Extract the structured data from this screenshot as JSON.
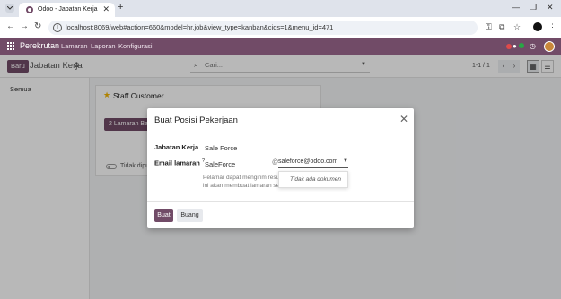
{
  "browser": {
    "tab_title": "Odoo - Jabatan Kerja",
    "new_tab": "+",
    "url": "localhost:8069/web#action=660&model=hr.job&view_type=kanban&cids=1&menu_id=471"
  },
  "navbar": {
    "brand": "Perekrutan",
    "menu": [
      "Lamaran",
      "Laporan",
      "Konfigurasi"
    ],
    "colors": {
      "primary": "#714b67"
    }
  },
  "controlpanel": {
    "new_button": "Baru",
    "title": "Jabatan Kerja",
    "search_placeholder": "Cari...",
    "pager": "1-1 / 1"
  },
  "sidebar": {
    "items": [
      {
        "label": "Semua"
      }
    ]
  },
  "card": {
    "title": "Staff Customer",
    "button": "2 Lamaran Baru",
    "toggle_label": "Tidak dipublikasikan"
  },
  "modal": {
    "title": "Buat Posisi Pekerjaan",
    "fields": {
      "job_label": "Jabatan Kerja",
      "job_value": "Sale Force",
      "email_label": "Email lamaran",
      "email_help_mark": "?",
      "email_alias": "SaleForce",
      "email_at": "@",
      "email_domain": "saleforce@odoo.com",
      "help_line1": "Pelamar dapat mengirim resume",
      "help_line2": "ini akan membuat lamaran secara"
    },
    "dropdown": {
      "empty_label": "Tidak ada dokumen"
    },
    "footer": {
      "create": "Buat",
      "discard": "Buang"
    }
  }
}
